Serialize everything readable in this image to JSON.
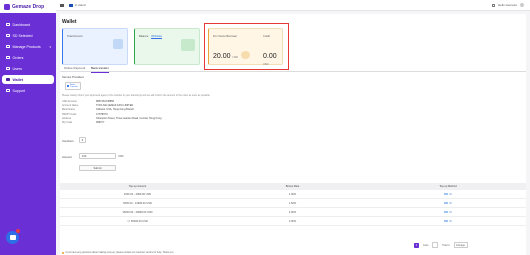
{
  "app": {
    "brand": "Gemaze Drop"
  },
  "topbar": {
    "store": "in stand",
    "help": "Hello Gemaze"
  },
  "sidebar": {
    "items": [
      {
        "label": "Dashboard",
        "icon": "dashboard-icon",
        "active": false,
        "has_children": false
      },
      {
        "label": "SD Selected",
        "icon": "star-icon",
        "active": false,
        "has_children": false
      },
      {
        "label": "Manage Products",
        "icon": "box-icon",
        "active": false,
        "has_children": true
      },
      {
        "label": "Orders",
        "icon": "cart-icon",
        "active": false,
        "has_children": false
      },
      {
        "label": "Users",
        "icon": "user-icon",
        "active": false,
        "has_children": false
      },
      {
        "label": "Wallet",
        "icon": "wallet-icon",
        "active": true,
        "has_children": false
      },
      {
        "label": "Support",
        "icon": "support-icon",
        "active": false,
        "has_children": false
      }
    ]
  },
  "page": {
    "title": "Wallet"
  },
  "cards": {
    "total_account": {
      "label": "Total Account"
    },
    "balance": {
      "label": "Balance",
      "action": "Withdraw"
    },
    "frozen": {
      "label": "Frm Vonne Borrower",
      "value": "20.00",
      "currency": "USD"
    },
    "credit": {
      "label": "Credit",
      "value": "0.00",
      "currency": "USD"
    }
  },
  "tabs": [
    {
      "label": "Online Payment",
      "active": false
    },
    {
      "label": "Bank transfer",
      "active": true
    }
  ],
  "bank": {
    "section_label": "Service Providers",
    "provider_name": "Bank Transfer",
    "notice": "Please clearly inform your approved agent of the transfer to your transfer(s) and we will confirm the amount of the order as soon as possible.",
    "details": [
      {
        "key": "USD Account",
        "value": "8857481748856"
      },
      {
        "key": "Account Name",
        "value": "TOOLIVE GEMAZ ASSI LIMITED"
      },
      {
        "key": "Bank Name",
        "value": "Citibank, USA, Hong Kong Branch"
      },
      {
        "key": "SWIFT Code",
        "value": "CITIHKHX"
      },
      {
        "key": "Address",
        "value": "Champion Tower, Three Garden Road, Central, Hong Kong"
      },
      {
        "key": "Zip Code",
        "value": "999077"
      }
    ]
  },
  "form": {
    "vouchers_label": "Vouchers",
    "vouchers_value": "0",
    "amount_label": "Amount",
    "amount_value": "100",
    "amount_unit": "USD",
    "submit_label": "Submit"
  },
  "table": {
    "headers": [
      "Top-up Amount",
      "Bonus Rate",
      "Top-up Method"
    ],
    "rows": [
      {
        "amount": "1000.00 - 4999.00 USD",
        "rate": "1.00%"
      },
      {
        "amount": "5000.00 - 14999.00 USD",
        "rate": "1.50%"
      },
      {
        "amount": "15000.00 - 49999.00 USD",
        "rate": "2.00%"
      },
      {
        "amount": ">= 50000.00 USD",
        "rate": "3.00%"
      }
    ]
  },
  "pager": {
    "current": "1",
    "total_text": "Total 4",
    "goto_label": "Goto",
    "per_page": "10/page"
  },
  "footnote": "If you have any questions about making a top-up, please contact our customer service for help. Thank you."
}
